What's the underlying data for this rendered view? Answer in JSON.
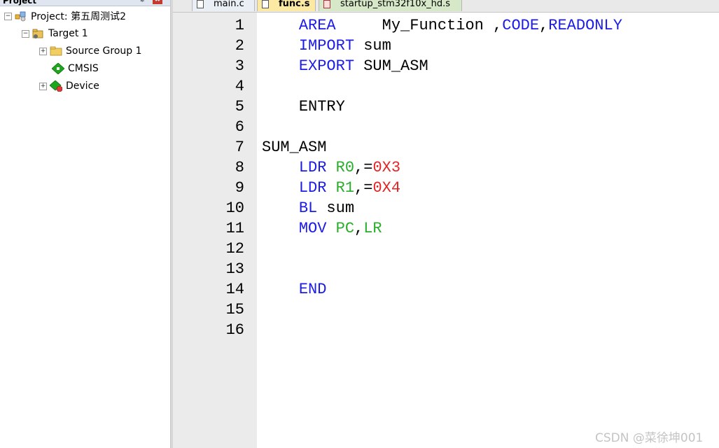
{
  "project_panel": {
    "title": "Project",
    "pin_glyph": "✵",
    "close_glyph": "✖",
    "project_label": "Project: 第五周测试2",
    "target_label": "Target 1",
    "items": [
      {
        "label": "Source Group 1",
        "icon": "folder-icon",
        "expanded": false
      },
      {
        "label": "CMSIS",
        "icon": "cmsis-component-icon",
        "expanded": null
      },
      {
        "label": "Device",
        "icon": "device-component-icon",
        "expanded": false
      }
    ],
    "expand_glyph": "+",
    "collapse_glyph": "−"
  },
  "tabs": [
    {
      "label": "main.c",
      "active": false
    },
    {
      "label": "func.s",
      "active": true
    },
    {
      "label": "startup_stm32f10x_hd.s",
      "active": false
    }
  ],
  "editor": {
    "line_numbers": [
      "1",
      "2",
      "3",
      "4",
      "5",
      "6",
      "7",
      "8",
      "9",
      "10",
      "11",
      "12",
      "13",
      "14",
      "15",
      "16"
    ],
    "lines": [
      {
        "indent": "    ",
        "parts": [
          {
            "t": "AREA",
            "c": "kw"
          },
          {
            "t": "     My_Function ,",
            "c": ""
          },
          {
            "t": "CODE",
            "c": "kw"
          },
          {
            "t": ",",
            "c": ""
          },
          {
            "t": "READONLY",
            "c": "kw"
          }
        ]
      },
      {
        "indent": "    ",
        "parts": [
          {
            "t": "IMPORT",
            "c": "kw"
          },
          {
            "t": " sum",
            "c": ""
          }
        ]
      },
      {
        "indent": "    ",
        "parts": [
          {
            "t": "EXPORT",
            "c": "kw"
          },
          {
            "t": " SUM_ASM",
            "c": ""
          }
        ]
      },
      {
        "indent": "",
        "parts": []
      },
      {
        "indent": "    ",
        "parts": [
          {
            "t": "ENTRY",
            "c": ""
          }
        ]
      },
      {
        "indent": "",
        "parts": []
      },
      {
        "indent": "",
        "parts": [
          {
            "t": "SUM_ASM",
            "c": ""
          }
        ]
      },
      {
        "indent": "    ",
        "parts": [
          {
            "t": "LDR",
            "c": "kw"
          },
          {
            "t": " ",
            "c": ""
          },
          {
            "t": "R0",
            "c": "reg"
          },
          {
            "t": ",=",
            "c": ""
          },
          {
            "t": "0X3",
            "c": "num"
          }
        ]
      },
      {
        "indent": "    ",
        "parts": [
          {
            "t": "LDR",
            "c": "kw"
          },
          {
            "t": " ",
            "c": ""
          },
          {
            "t": "R1",
            "c": "reg"
          },
          {
            "t": ",=",
            "c": ""
          },
          {
            "t": "0X4",
            "c": "num"
          }
        ]
      },
      {
        "indent": "    ",
        "parts": [
          {
            "t": "BL",
            "c": "kw"
          },
          {
            "t": " sum",
            "c": ""
          }
        ]
      },
      {
        "indent": "    ",
        "parts": [
          {
            "t": "MOV",
            "c": "kw"
          },
          {
            "t": " ",
            "c": ""
          },
          {
            "t": "PC",
            "c": "reg"
          },
          {
            "t": ",",
            "c": ""
          },
          {
            "t": "LR",
            "c": "reg"
          }
        ]
      },
      {
        "indent": "",
        "parts": []
      },
      {
        "indent": "",
        "parts": []
      },
      {
        "indent": "    ",
        "parts": [
          {
            "t": "END",
            "c": "kw"
          }
        ]
      },
      {
        "indent": "",
        "parts": []
      },
      {
        "indent": "",
        "parts": []
      }
    ]
  },
  "watermark": "CSDN @菜徐坤001",
  "colors": {
    "keyword": "#1c1ce8",
    "register": "#2aad2a",
    "number": "#e42424",
    "gutter": "#ebebeb",
    "active_tab": "#fbe9a4"
  }
}
